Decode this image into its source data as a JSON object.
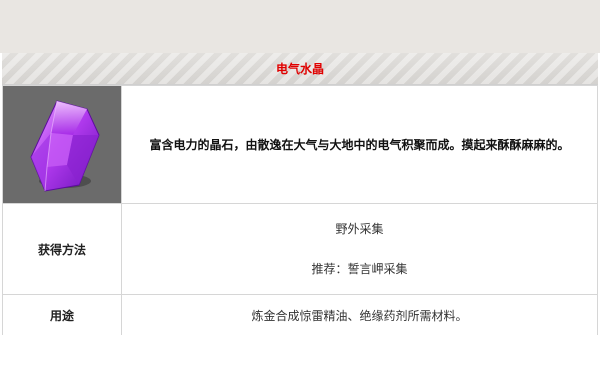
{
  "item": {
    "title": "电气水晶",
    "icon": "purple-crystal-icon",
    "description": "富含电力的晶石，由散逸在大气与大地中的电气积聚而成。摸起来酥酥麻麻的。"
  },
  "rows": {
    "source_label": "获得方法",
    "source_lines": [
      "野外采集",
      "推荐：誓言岬采集"
    ],
    "use_label": "用途",
    "use_value": "炼金合成惊雷精油、绝缘药剂所需材料。"
  },
  "colors": {
    "title": "#e00000",
    "crystal": "#b43cf0",
    "image_bg": "#6b6b6b"
  }
}
